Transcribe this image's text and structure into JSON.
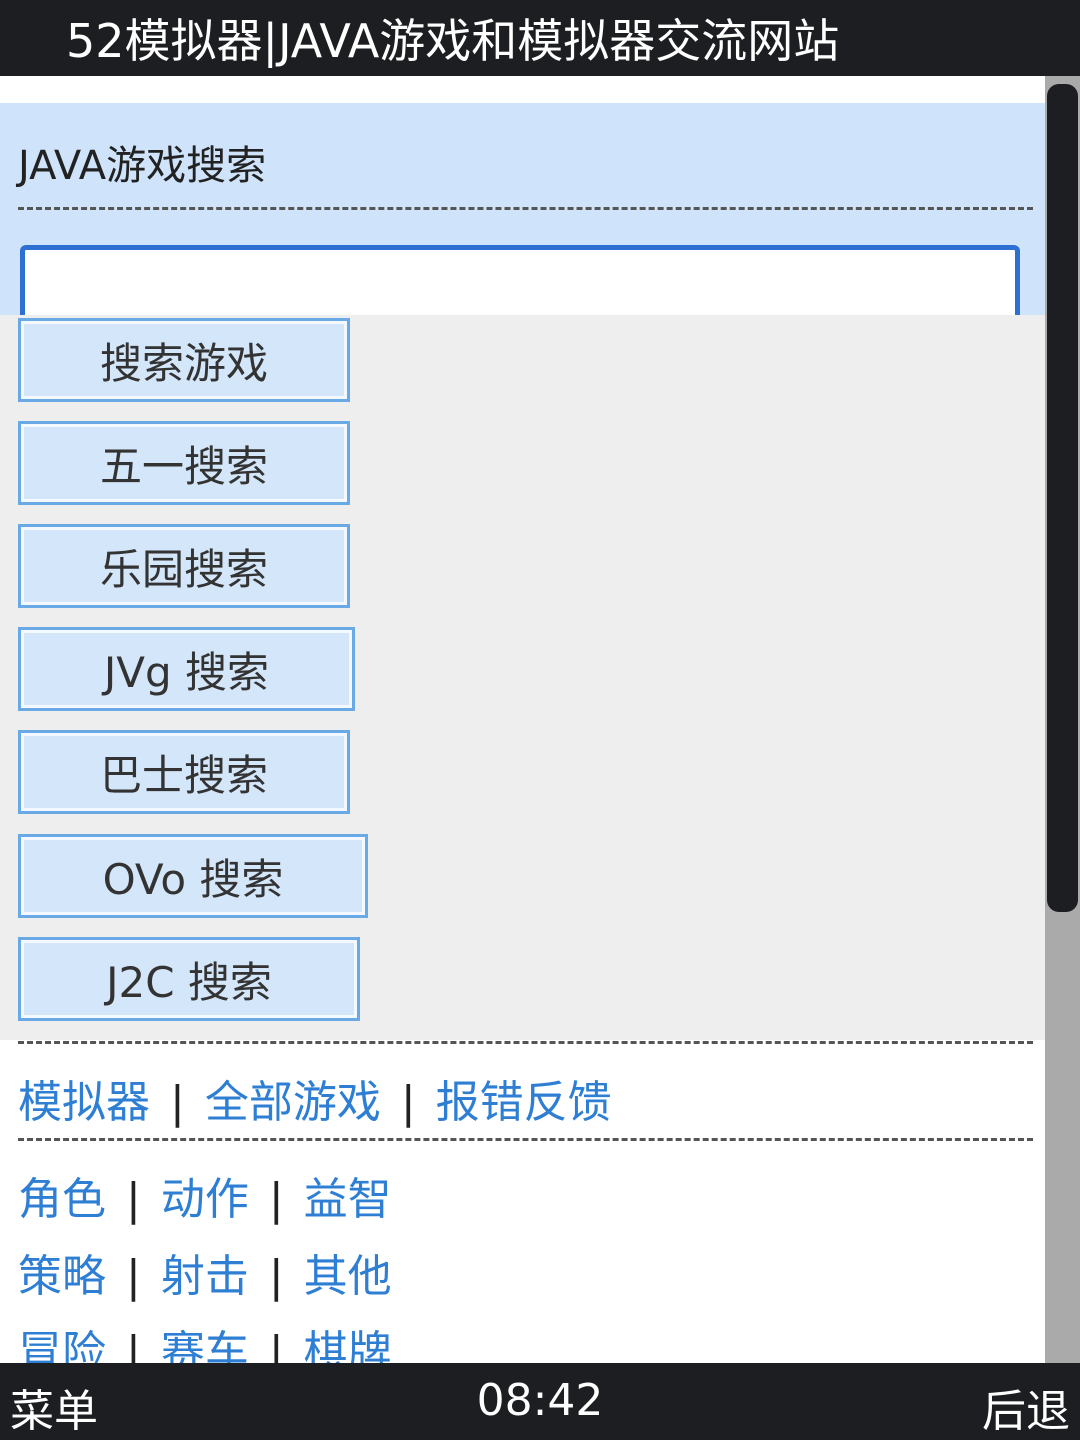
{
  "title_bar": {
    "title": "52模拟器|JAVA游戏和模拟器交流网站"
  },
  "search": {
    "heading": "JAVA游戏搜索",
    "input_value": "",
    "buttons": [
      "搜索游戏",
      "五一搜索",
      "乐园搜索",
      "JVg 搜索",
      "巴士搜索",
      "OVo 搜索",
      "J2C 搜索"
    ]
  },
  "nav_links": [
    "模拟器",
    "全部游戏",
    "报错反馈"
  ],
  "categories": [
    [
      "角色",
      "动作",
      "益智"
    ],
    [
      "策略",
      "射击",
      "其他"
    ],
    [
      "冒险",
      "赛车",
      "棋牌"
    ]
  ],
  "separator": "|",
  "softkeys": {
    "left": "菜单",
    "center": "08:42",
    "right": "后退"
  },
  "colors": {
    "link": "#2e7fd4",
    "search_bg": "#cfe3fb",
    "button_bg": "#d4e6fa",
    "bar_bg": "#1c1e22"
  }
}
